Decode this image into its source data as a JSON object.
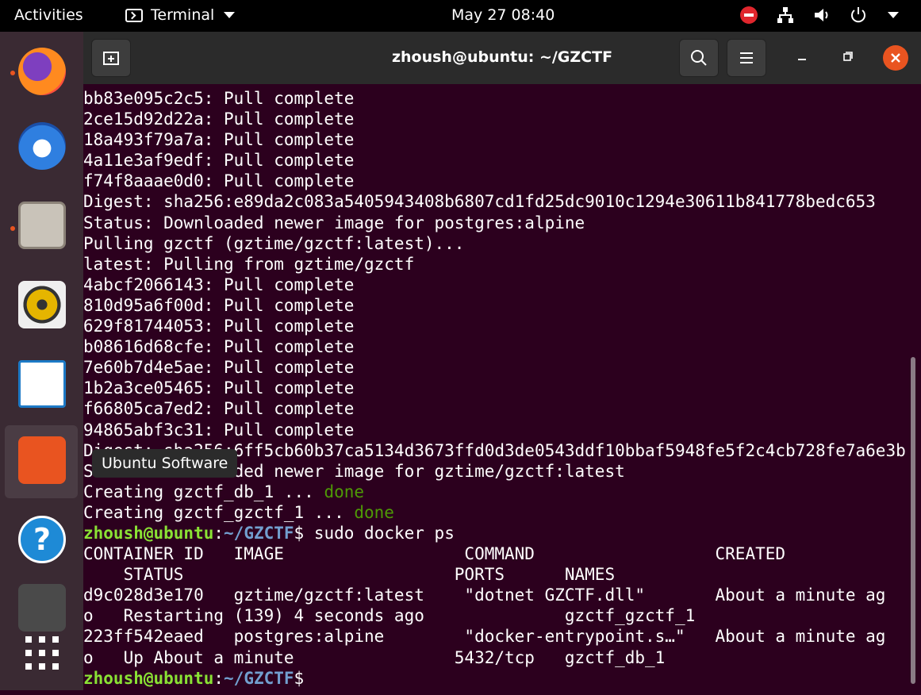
{
  "topbar": {
    "activities": "Activities",
    "app_menu": "Terminal",
    "clock": "May 27  08:40"
  },
  "dock": {
    "tooltip": "Ubuntu Software",
    "items": [
      "firefox-icon",
      "thunderbird-icon",
      "files-icon",
      "rhythmbox-icon",
      "libreoffice-writer-icon",
      "ubuntu-software-icon",
      "help-icon",
      "terminal-icon",
      "show-applications-icon"
    ]
  },
  "window": {
    "title": "zhoush@ubuntu: ~/GZCTF"
  },
  "colors": {
    "accent": "#e95420",
    "terminal_bg": "#2c001e",
    "prompt_user": "#8ae234",
    "prompt_path": "#729fcf",
    "done": "#4e9a06"
  },
  "terminal": {
    "lines_before": [
      "bb83e095c2c5: Pull complete",
      "2ce15d92d22a: Pull complete",
      "18a493f79a7a: Pull complete",
      "4a11e3af9edf: Pull complete",
      "f74f8aaae0d0: Pull complete",
      "Digest: sha256:e89da2c083a5405943408b6807cd1fd25dc9010c1294e30611b841778bedc653",
      "Status: Downloaded newer image for postgres:alpine",
      "Pulling gzctf (gztime/gzctf:latest)...",
      "latest: Pulling from gztime/gzctf",
      "4abcf2066143: Pull complete",
      "810d95a6f00d: Pull complete",
      "629f81744053: Pull complete",
      "b08616d68cfe: Pull complete",
      "7e60b7d4e5ae: Pull complete",
      "1b2a3ce05465: Pull complete",
      "f66805ca7ed2: Pull complete",
      "94865abf3c31: Pull complete",
      "Digest: sha256:6ff5cb60b37ca5134d3673ffd0d3de0543ddf10bbaf5948fe5f2c4cb728fe7a6e3b",
      "Status: Downloaded newer image for gztime/gzctf:latest"
    ],
    "create_db": "Creating gzctf_db_1 ... ",
    "create_gzctf": "Creating gzctf_gzctf_1 ... ",
    "done": "done",
    "prompt_user": "zhoush@ubuntu",
    "prompt_sep": ":",
    "prompt_path": "~/GZCTF",
    "prompt_dollar": "$ ",
    "command": "sudo docker ps",
    "table_lines": [
      "CONTAINER ID   IMAGE                  COMMAND                  CREATED",
      "    STATUS                           PORTS      NAMES",
      "d9c028d3e170   gztime/gzctf:latest    \"dotnet GZCTF.dll\"       About a minute ag",
      "o   Restarting (139) 4 seconds ago              gzctf_gzctf_1",
      "223ff542eaed   postgres:alpine        \"docker-entrypoint.s…\"   About a minute ag",
      "o   Up About a minute                5432/tcp   gzctf_db_1"
    ]
  }
}
